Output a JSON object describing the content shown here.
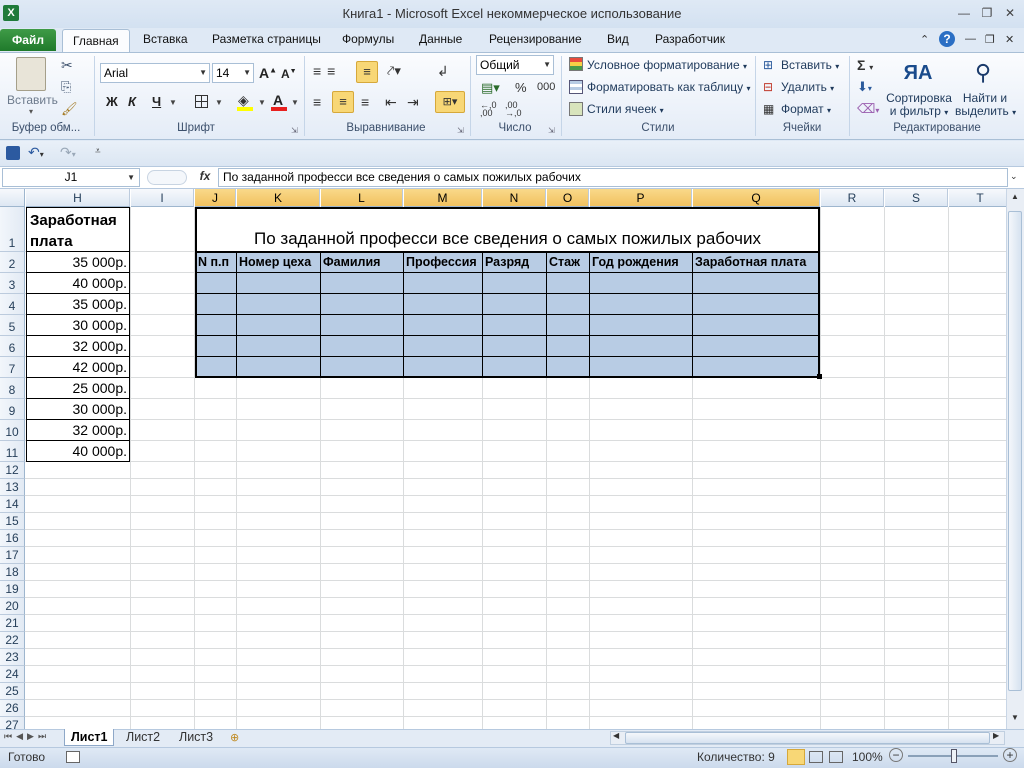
{
  "window": {
    "title": "Книга1  -  Microsoft Excel некоммерческое использование",
    "app_icon": "X"
  },
  "tabs": {
    "file": "Файл",
    "items": [
      "Главная",
      "Вставка",
      "Разметка страницы",
      "Формулы",
      "Данные",
      "Рецензирование",
      "Вид",
      "Разработчик"
    ]
  },
  "ribbon": {
    "clipboard": {
      "paste": "Вставить",
      "label": "Буфер обм..."
    },
    "font": {
      "name": "Arial",
      "size": "14",
      "bold": "Ж",
      "italic": "К",
      "underline": "Ч",
      "label": "Шрифт"
    },
    "alignment": {
      "label": "Выравнивание"
    },
    "number": {
      "format": "Общий",
      "percent": "%",
      "thousands": "000",
      "label": "Число"
    },
    "styles": {
      "conditional": "Условное форматирование",
      "as_table": "Форматировать как таблицу",
      "cell_styles": "Стили ячеек",
      "label": "Стили"
    },
    "cells": {
      "insert": "Вставить",
      "delete": "Удалить",
      "format": "Формат",
      "label": "Ячейки"
    },
    "editing": {
      "sort": "Сортировка\nи фильтр",
      "sort1": "Сортировка",
      "sort2": "и фильтр",
      "find1": "Найти и",
      "find2": "выделить",
      "label": "Редактирование"
    }
  },
  "formula_bar": {
    "name_box": "J1",
    "fx": "fx",
    "content": "По заданной професси все сведения о самых пожилых рабочих"
  },
  "columns": [
    "H",
    "I",
    "J",
    "K",
    "L",
    "M",
    "N",
    "O",
    "P",
    "Q",
    "R",
    "S",
    "T"
  ],
  "rows": [
    "1",
    "2",
    "3",
    "4",
    "5",
    "6",
    "7",
    "8",
    "9",
    "10",
    "11",
    "12",
    "13",
    "14",
    "15",
    "16",
    "17",
    "18",
    "19",
    "20",
    "21",
    "22",
    "23",
    "24",
    "25",
    "26",
    "27"
  ],
  "column_h": {
    "header": "Заработная плата",
    "header1": "Заработная",
    "header2": "плата",
    "values": [
      "35 000р.",
      "40 000р.",
      "35 000р.",
      "30 000р.",
      "32 000р.",
      "42 000р.",
      "25 000р.",
      "30 000р.",
      "32 000р.",
      "40 000р."
    ]
  },
  "table": {
    "title": "По заданной професси все сведения о самых пожилых рабочих",
    "headers": [
      "N п.п",
      "Номер цеха",
      "Фамилия",
      "Профессия",
      "Разряд",
      "Стаж",
      "Год рождения",
      "Заработная плата"
    ]
  },
  "sheet_tabs": [
    "Лист1",
    "Лист2",
    "Лист3"
  ],
  "status": {
    "ready": "Готово",
    "count": "Количество: 9",
    "zoom": "100%"
  },
  "colors": {
    "selection_fill": "#b8cce4",
    "header_selected": "#f5c96b",
    "excel_green": "#1f7a2b"
  }
}
